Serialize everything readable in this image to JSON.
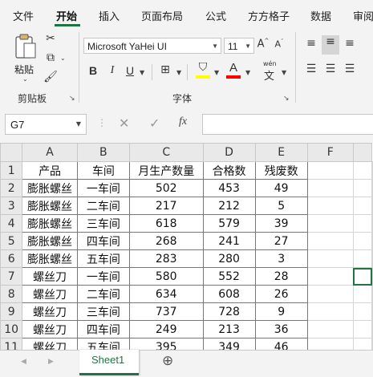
{
  "tabs": [
    "文件",
    "开始",
    "插入",
    "页面布局",
    "公式",
    "方方格子",
    "数据",
    "审阅"
  ],
  "active_tab": "开始",
  "ribbon": {
    "clipboard": {
      "paste_label": "粘贴",
      "group_label": "剪贴板"
    },
    "font": {
      "font_name": "Microsoft YaHei UI",
      "font_size": "11",
      "bold": "B",
      "italic": "I",
      "underline": "U",
      "wen_label": "wén",
      "wen_char": "文",
      "group_label": "字体",
      "highlight_color": "#ffff00",
      "font_color": "#ff0000"
    }
  },
  "formula_bar": {
    "name_box": "G7",
    "fx": "fx",
    "formula": ""
  },
  "sheet": {
    "col_headers": [
      "A",
      "B",
      "C",
      "D",
      "E",
      "F"
    ],
    "row_numbers": [
      "1",
      "2",
      "3",
      "4",
      "5",
      "6",
      "7",
      "8",
      "9",
      "10",
      "11"
    ],
    "selected_cell": "G7",
    "rows": [
      [
        "产品",
        "车间",
        "月生产数量",
        "合格数",
        "残废数"
      ],
      [
        "膨胀螺丝",
        "一车间",
        "502",
        "453",
        "49"
      ],
      [
        "膨胀螺丝",
        "二车间",
        "217",
        "212",
        "5"
      ],
      [
        "膨胀螺丝",
        "三车间",
        "618",
        "579",
        "39"
      ],
      [
        "膨胀螺丝",
        "四车间",
        "268",
        "241",
        "27"
      ],
      [
        "膨胀螺丝",
        "五车间",
        "283",
        "280",
        "3"
      ],
      [
        "螺丝刀",
        "一车间",
        "580",
        "552",
        "28"
      ],
      [
        "螺丝刀",
        "二车间",
        "634",
        "608",
        "26"
      ],
      [
        "螺丝刀",
        "三车间",
        "737",
        "728",
        "9"
      ],
      [
        "螺丝刀",
        "四车间",
        "249",
        "213",
        "36"
      ],
      [
        "螺丝刀",
        "五车间",
        "395",
        "349",
        "46"
      ]
    ]
  },
  "sheet_tabs": {
    "names": [
      "Sheet1"
    ],
    "add_label": "⊕"
  },
  "accent_color": "#217346"
}
